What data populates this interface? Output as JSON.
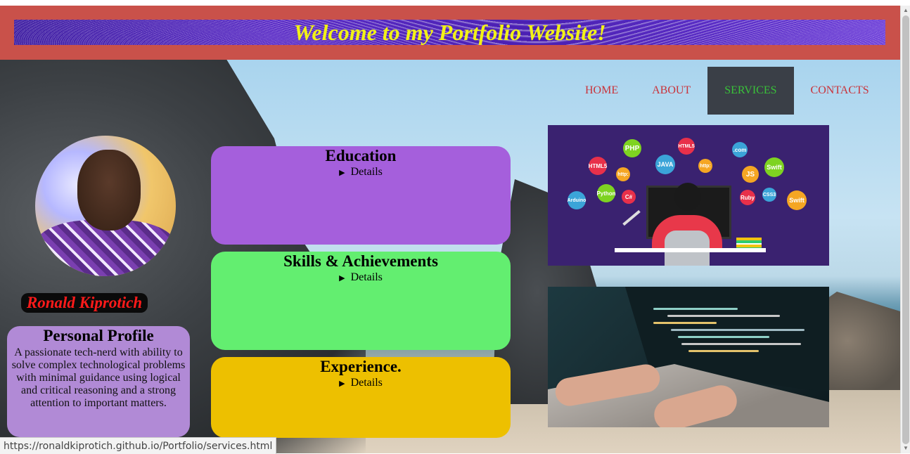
{
  "header": {
    "banner_title": "Welcome to my Portfolio Website!"
  },
  "nav": {
    "items": [
      {
        "label": "HOME",
        "active": false
      },
      {
        "label": "ABOUT",
        "active": false
      },
      {
        "label": "SERVICES",
        "active": true
      },
      {
        "label": "CONTACTS",
        "active": false
      }
    ]
  },
  "profile": {
    "name": "Ronald Kiprotich",
    "card_title": "Personal Profile",
    "description": "A passionate tech-nerd with ability to solve complex technological problems with minimal guidance using logical and critical reasoning and a strong attention to important matters."
  },
  "sections": [
    {
      "title": "Education",
      "summary": "Details",
      "color": "#a55fdc"
    },
    {
      "title": "Skills & Achievements",
      "summary": "Details",
      "color": "#63ee70"
    },
    {
      "title": "Experience.",
      "summary": "Details",
      "color": "#edc000"
    }
  ],
  "illustration": {
    "bubbles": [
      "PHP",
      "HTML5",
      "JAVA",
      "http:",
      ".com",
      "Swift",
      "HTML5",
      "http:",
      "Python",
      "C#",
      "JS",
      "Ruby",
      "CSS3",
      "Swift",
      "Arduino"
    ]
  },
  "status_bar": {
    "url": "https://ronaldkiprotich.github.io/Portfolio/services.html"
  },
  "colors": {
    "header_bg": "#c9514a",
    "banner_text": "#f2f216",
    "nav_text": "#c9333a",
    "nav_active_bg": "#3a3f47",
    "nav_active_text": "#39c239",
    "name_text": "#ff1a1a",
    "profile_bg": "#b18ad6"
  }
}
